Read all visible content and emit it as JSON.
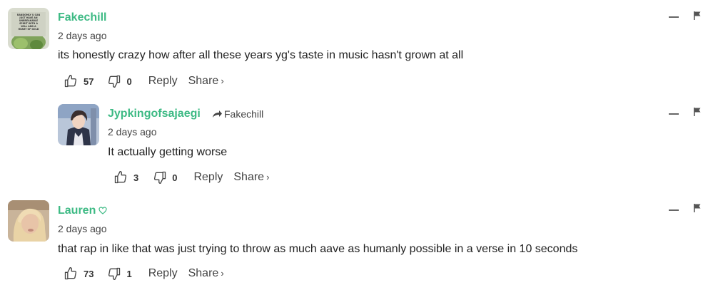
{
  "colors": {
    "username": "#3dba84",
    "text": "#222222",
    "muted": "#444444"
  },
  "comments": [
    {
      "username": "Fakechill",
      "avatar_text": "RANDOMLY U CAN JUST HAVE AN UNBREAKABLE SPIRIT WITH A WILL AND A HEART OF GOLD",
      "timestamp": "2 days ago",
      "text": "its honestly crazy how after all these years yg's taste in music hasn't grown at all",
      "likes": "57",
      "dislikes": "0",
      "reply_label": "Reply",
      "share_label": "Share",
      "share_chevron": "›",
      "replies": [
        {
          "username": "Jypkingofsajaegi",
          "reply_to": "Fakechill",
          "timestamp": "2 days ago",
          "text": "It actually getting worse",
          "likes": "3",
          "dislikes": "0",
          "reply_label": "Reply",
          "share_label": "Share",
          "share_chevron": "›"
        }
      ]
    },
    {
      "username": "Lauren",
      "badge_icon": "heart-outline-icon",
      "timestamp": "2 days ago",
      "text": "that rap in like that was just trying to throw as much aave as humanly possible in a verse in 10 seconds",
      "likes": "73",
      "dislikes": "1",
      "reply_label": "Reply",
      "share_label": "Share",
      "share_chevron": "›"
    }
  ]
}
